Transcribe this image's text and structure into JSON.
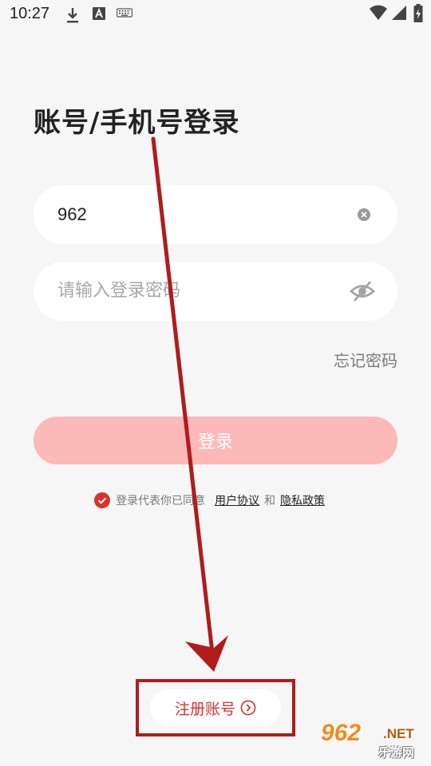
{
  "status_bar": {
    "time": "10:27",
    "icons": [
      "download-icon",
      "font-icon",
      "keyboard-icon",
      "wifi-icon",
      "signal-icon",
      "battery-charging-icon"
    ]
  },
  "login": {
    "title": "账号/手机号登录",
    "account_value": "962",
    "password_placeholder": "请输入登录密码",
    "forgot_password": "忘记密码",
    "login_button": "登录"
  },
  "agreement": {
    "prefix": "登录代表你已同意",
    "user_agreement": "用户协议",
    "conjunction": "和",
    "privacy_policy": "隐私政策",
    "checked": true
  },
  "register": {
    "label": "注册账号"
  },
  "watermark": {
    "logo": "962",
    "suffix": ".NET",
    "caption": "乐游网"
  },
  "colors": {
    "accent_red": "#d8322c",
    "login_button_disabled": "#fdb8b8",
    "annotation_red": "#b01c1c",
    "background": "#f6f6f6"
  }
}
